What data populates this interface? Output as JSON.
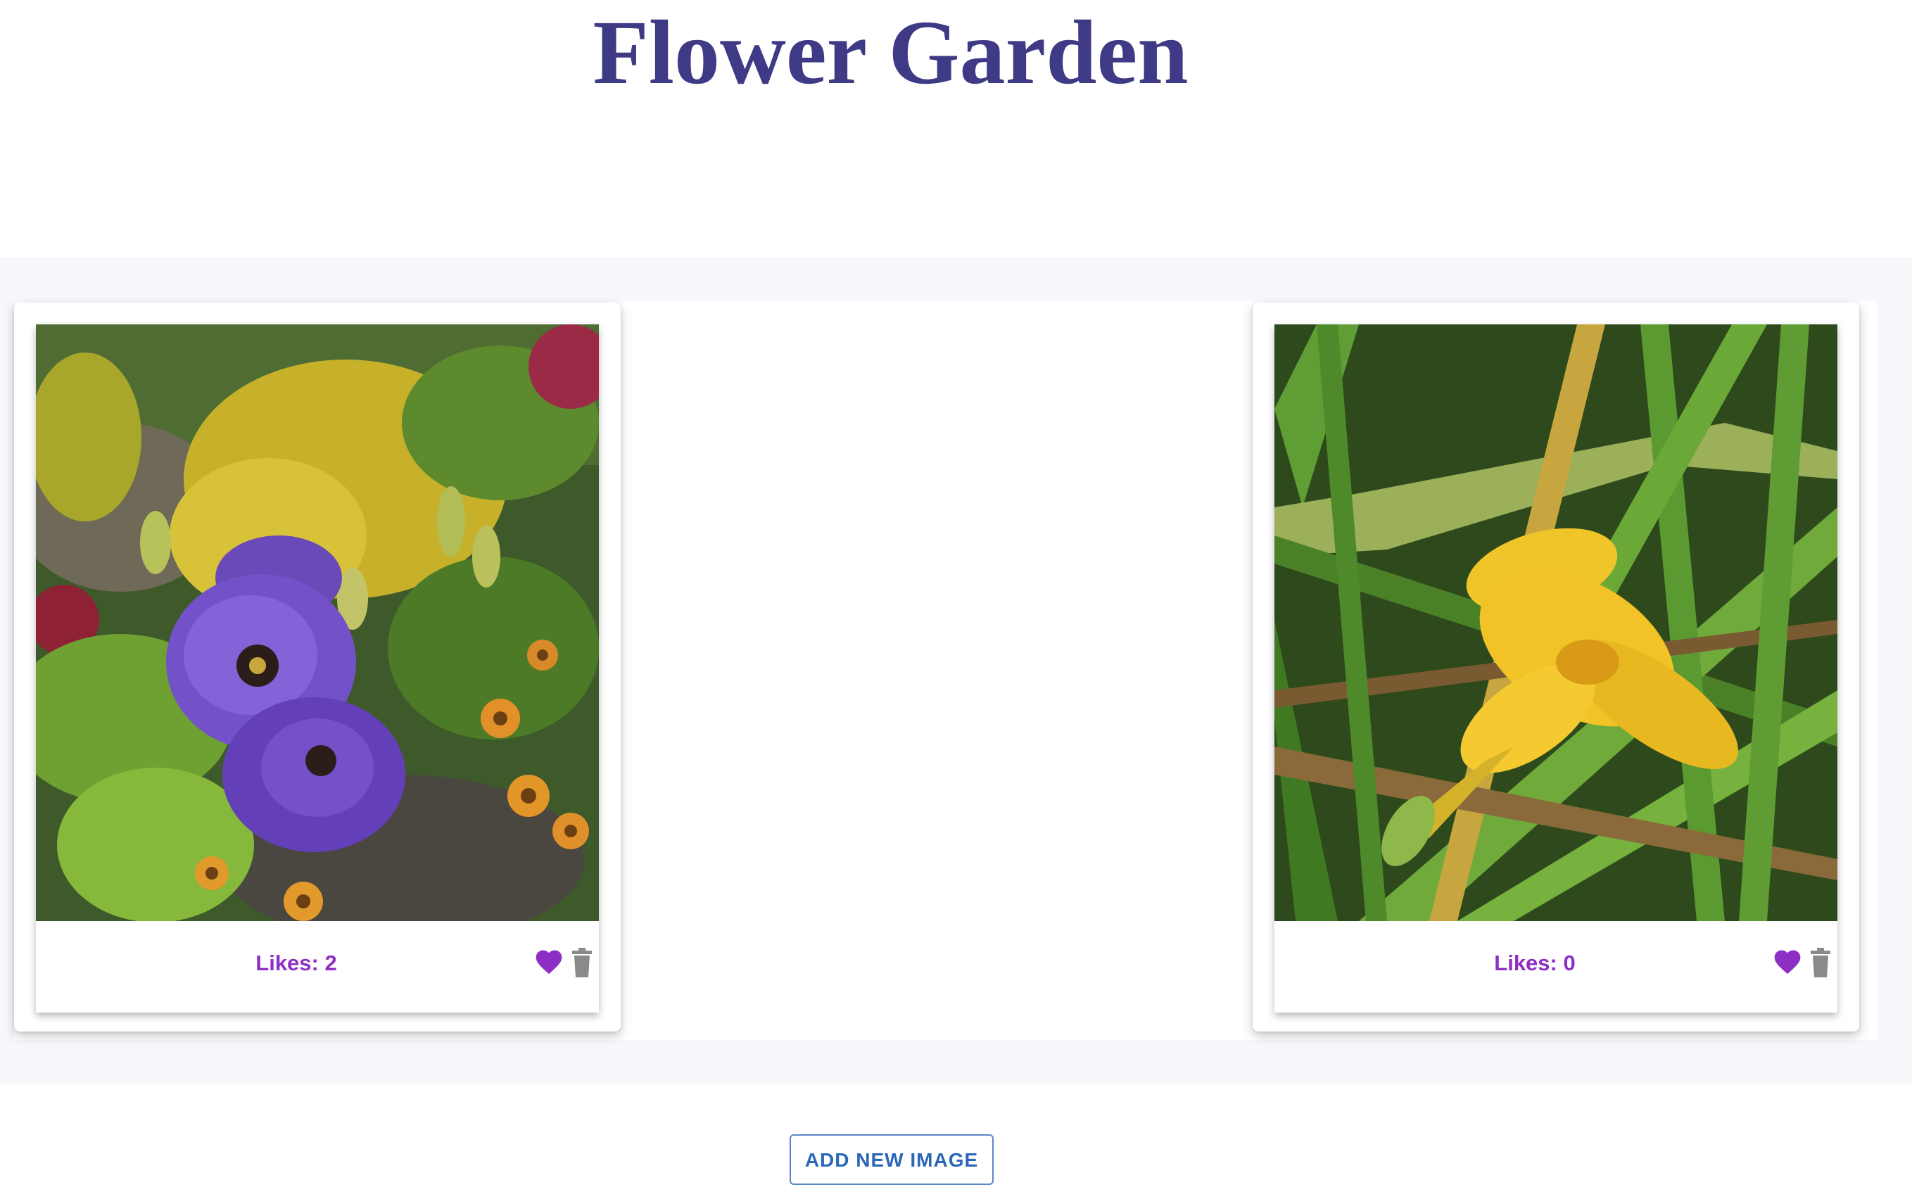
{
  "header": {
    "title": "Flower Garden"
  },
  "gallery": {
    "cards": [
      {
        "photo_name": "purple-flower-photo",
        "likes_text": "Likes: 2",
        "like_icon": "heart-icon",
        "delete_icon": "trash-icon"
      },
      {
        "photo_name": "yellow-lily-photo",
        "likes_text": "Likes: 0",
        "like_icon": "heart-icon",
        "delete_icon": "trash-icon"
      }
    ]
  },
  "actions": {
    "add_new_image_label": "ADD NEW IMAGE"
  },
  "colors": {
    "title": "#3f3a86",
    "likes": "#8e2fc4",
    "heart": "#8e2fc4",
    "trash": "#8a8a8a",
    "button_text": "#2a67b8",
    "band": "#f8f8fc"
  }
}
